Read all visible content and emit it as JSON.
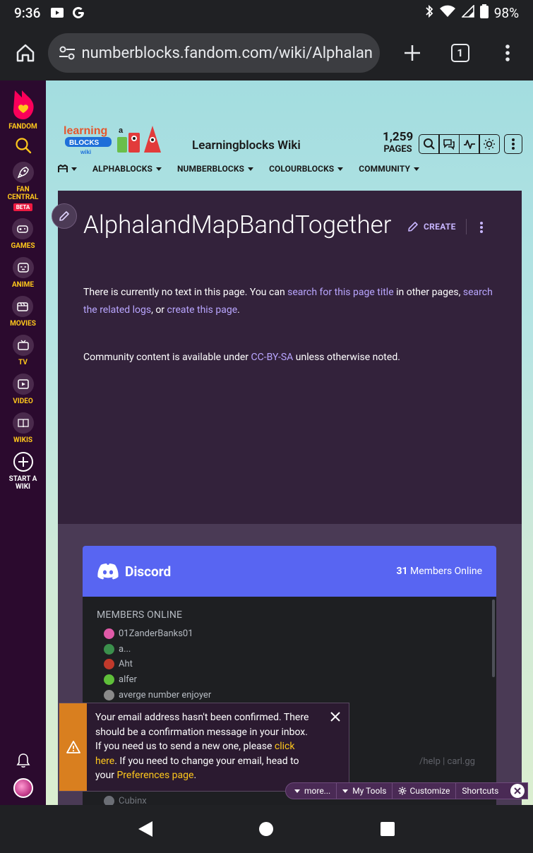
{
  "status_bar": {
    "time": "9:36",
    "battery": "98%"
  },
  "browser": {
    "url": "numberblocks.fandom.com/wiki/Alphalan",
    "tab_count": "1"
  },
  "rail": {
    "brand": "FANDOM",
    "items": [
      {
        "label": "FAN CENTRAL",
        "badge": "BETA"
      },
      {
        "label": "GAMES"
      },
      {
        "label": "ANIME"
      },
      {
        "label": "MOVIES"
      },
      {
        "label": "TV"
      },
      {
        "label": "VIDEO"
      },
      {
        "label": "WIKIS"
      },
      {
        "label": "START A WIKI"
      }
    ]
  },
  "wiki": {
    "name": "Learningblocks Wiki",
    "page_count": "1,259",
    "page_count_label": "PAGES",
    "logo_text": [
      "learning",
      "a",
      "BLOCKS",
      "wiki"
    ],
    "nav": [
      "ALPHABLOCKS",
      "NUMBERBLOCKS",
      "COLOURBLOCKS",
      "COMMUNITY"
    ]
  },
  "article": {
    "title": "AlphalandMapBandTogether",
    "create_label": "CREATE",
    "notext": {
      "before": "There is currently no text in this page. You can ",
      "link1": "search for this page title",
      "middle1": " in other pages, ",
      "link2": "search the related logs",
      "middle2": ", or ",
      "link3": "create this page",
      "after": "."
    },
    "license": {
      "before": "Community content is available under ",
      "link": "CC-BY-SA",
      "after": " unless otherwise noted."
    }
  },
  "discord": {
    "brand": "Discord",
    "online_count": "31",
    "online_label": " Members Online",
    "members_heading": "MEMBERS ONLINE",
    "members": [
      {
        "name": "01ZanderBanks01",
        "color": "#e05aa8"
      },
      {
        "name": "a...",
        "color": "#3b8f4c"
      },
      {
        "name": "Aht",
        "color": "#c0392b"
      },
      {
        "name": "alfer",
        "color": "#5fbf3a"
      },
      {
        "name": "averge number enjoyer",
        "color": "#8a8a8a"
      }
    ],
    "footer": "/help | carl.gg",
    "faded_member": "Cubinx"
  },
  "toast": {
    "before": "Your email address hasn't been confirmed. There should be a confirmation message in your inbox. If you need us to send a new one, please ",
    "link1": "click here",
    "middle": ". If you need to change your email, head to your ",
    "link2": "Preferences page",
    "after": "."
  },
  "tools": {
    "more": "more...",
    "my_tools": "My Tools",
    "customize": "Customize",
    "shortcuts": "Shortcuts"
  },
  "colors": {
    "fandom_rail": "#2b0a2e",
    "fandom_yellow": "#fec71c",
    "content_bg": "#33223b",
    "link": "#b9a6ff",
    "discord_blurple": "#5865f2",
    "warning": "#d97f1f"
  }
}
